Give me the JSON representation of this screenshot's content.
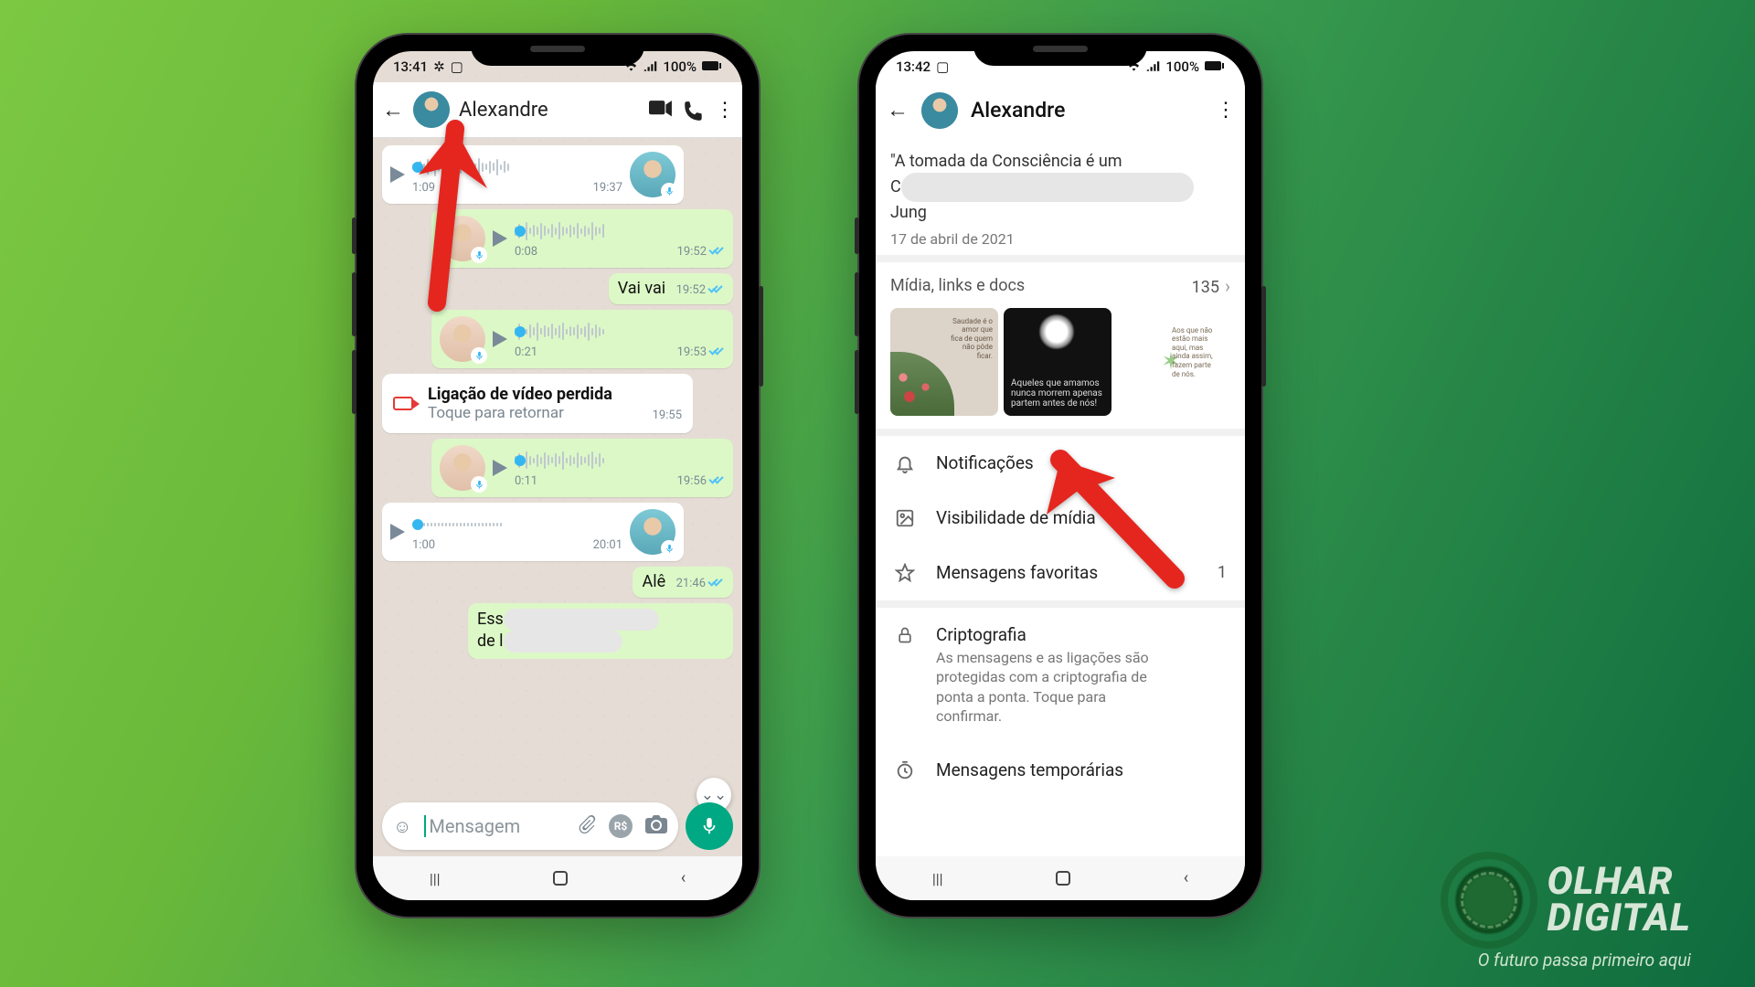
{
  "phone_left": {
    "status": {
      "time": "13:41",
      "battery": "100%"
    },
    "header": {
      "name": "Alexandre"
    },
    "messages": [
      {
        "kind": "voice_in",
        "duration": "1:09",
        "time": "19:37"
      },
      {
        "kind": "voice_out",
        "duration": "0:08",
        "time": "19:52"
      },
      {
        "kind": "text_out",
        "text": "Vai vai",
        "time": "19:52"
      },
      {
        "kind": "voice_out",
        "duration": "0:21",
        "time": "19:53"
      },
      {
        "kind": "missed_call",
        "title": "Ligação de vídeo perdida",
        "subtitle": "Toque para retornar",
        "time": "19:55"
      },
      {
        "kind": "voice_out",
        "duration": "0:11",
        "time": "19:56"
      },
      {
        "kind": "voice_in",
        "duration": "1:00",
        "time": "20:01"
      },
      {
        "kind": "text_out",
        "text": "Alê",
        "time": "21:46"
      },
      {
        "kind": "text_out_partial",
        "line1": "Ess",
        "line2": "de l"
      }
    ],
    "input": {
      "placeholder": "Mensagem"
    }
  },
  "phone_right": {
    "status": {
      "time": "13:42",
      "battery": "100%"
    },
    "header": {
      "name": "Alexandre"
    },
    "quote": {
      "line1": "\"A tomada da Consciência é um",
      "line2a": "C",
      "line3": "Jung",
      "date": "17 de abril de 2021"
    },
    "media": {
      "label": "Mídia, links e docs",
      "count": "135"
    },
    "thumb2_caption": "Aqueles que amamos nunca morrem apenas partem antes de nós!",
    "options": {
      "notifications": "Notificações",
      "media_visibility": "Visibilidade de mídia",
      "starred": "Mensagens favoritas",
      "starred_count": "1",
      "encryption": "Criptografia",
      "encryption_sub": "As mensagens e as ligações são protegidas com a criptografia de ponta a ponta. Toque para confirmar.",
      "disappearing": "Mensagens temporárias"
    }
  },
  "brand": {
    "line1": "OLHAR",
    "line2": "DIGITAL",
    "tagline": "O futuro passa primeiro aqui"
  }
}
